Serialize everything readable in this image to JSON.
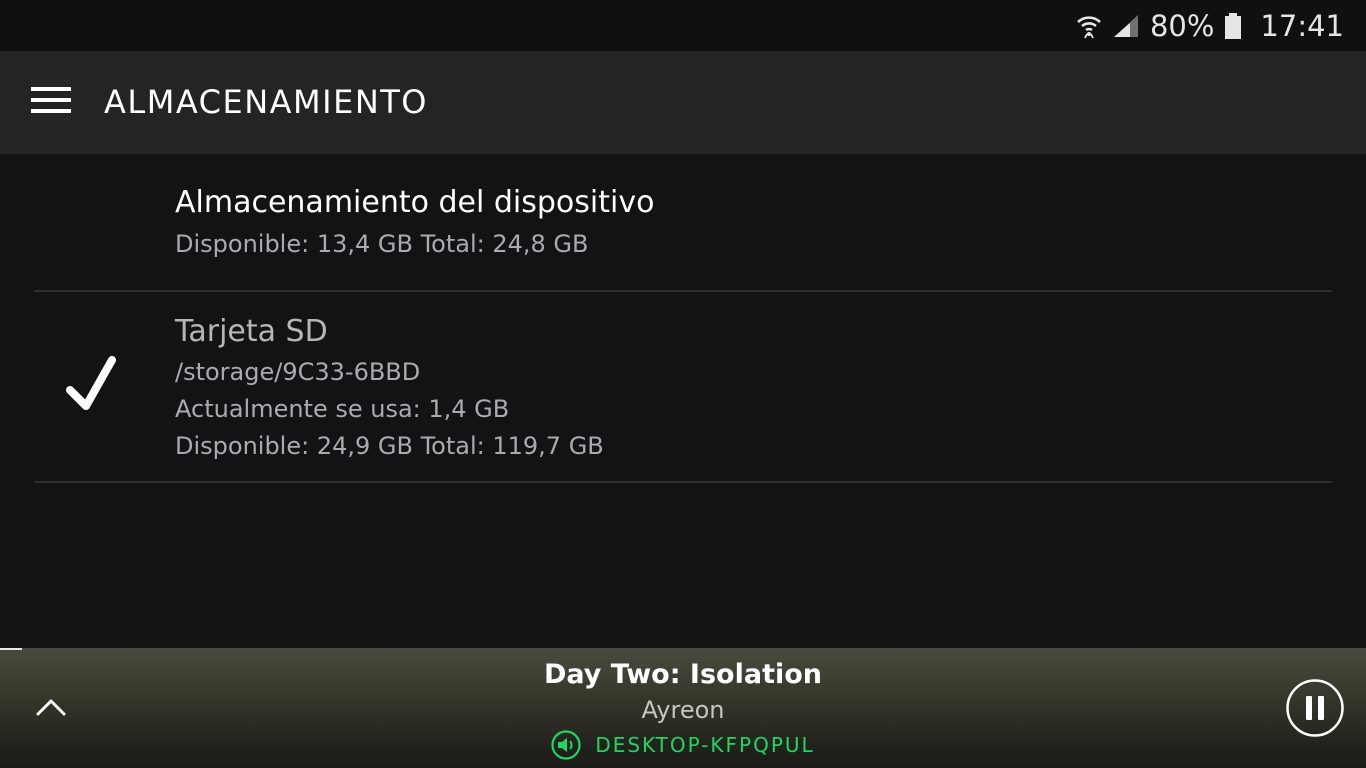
{
  "status_bar": {
    "battery_percent": "80%",
    "time": "17:41",
    "icons": [
      "wifi-icon",
      "signal-icon",
      "battery-icon"
    ]
  },
  "app_bar": {
    "title": "ALMACENAMIENTO",
    "menu_icon": "hamburger-menu-icon"
  },
  "storage_options": [
    {
      "title": "Almacenamiento del dispositivo",
      "details": [
        "Disponible: 13,4 GB Total: 24,8 GB"
      ],
      "selected": false
    },
    {
      "title": "Tarjeta SD",
      "details": [
        "/storage/9C33-6BBD",
        "Actualmente se usa: 1,4 GB",
        "Disponible: 24,9 GB Total: 119,7 GB"
      ],
      "selected": true
    }
  ],
  "now_playing": {
    "track": "Day Two: Isolation",
    "artist": "Ayreon",
    "device": "DESKTOP-KFPQPUL",
    "device_icon": "speaker-icon",
    "accent_color": "#1ed760",
    "expand_icon": "chevron-up-icon",
    "pause_icon": "pause-icon"
  }
}
